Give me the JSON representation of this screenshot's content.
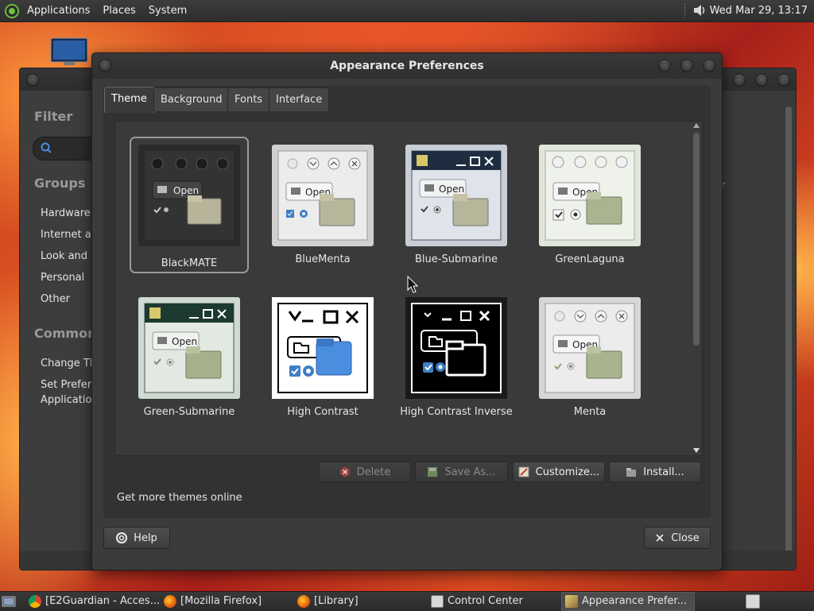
{
  "top_panel": {
    "menus": [
      "Applications",
      "Places",
      "System"
    ],
    "clock": "Wed Mar 29, 13:17"
  },
  "control_center": {
    "filter_heading": "Filter",
    "groups_heading": "Groups",
    "groups": [
      "Hardware",
      "Internet ar",
      "Look and F",
      "Personal",
      "Other"
    ],
    "common_heading": "Common",
    "common": [
      "Change Th",
      "Set Prefer",
      "Applicatio"
    ],
    "stray_char": "r"
  },
  "dialog": {
    "title": "Appearance Preferences",
    "tabs": [
      "Theme",
      "Background",
      "Fonts",
      "Interface"
    ],
    "active_tab": "Theme",
    "themes": [
      {
        "name": "BlackMATE",
        "selected": true
      },
      {
        "name": "BlueMenta",
        "selected": false
      },
      {
        "name": "Blue-Submarine",
        "selected": false
      },
      {
        "name": "GreenLaguna",
        "selected": false
      },
      {
        "name": "Green-Submarine",
        "selected": false
      },
      {
        "name": "High Contrast",
        "selected": false
      },
      {
        "name": "High Contrast Inverse",
        "selected": false
      },
      {
        "name": "Menta",
        "selected": false
      }
    ],
    "preview_open_label": "Open",
    "buttons": {
      "delete": "Delete",
      "save_as": "Save As...",
      "customize": "Customize...",
      "install": "Install..."
    },
    "more_themes_link": "Get more themes online",
    "help": "Help",
    "close": "Close"
  },
  "taskbar": {
    "tasks": [
      {
        "label": "[E2Guardian - Acces...",
        "icon": "chrome-icon"
      },
      {
        "label": "[Mozilla Firefox]",
        "icon": "firefox-icon"
      },
      {
        "label": "[Library]",
        "icon": "firefox-icon"
      },
      {
        "label": "Control Center",
        "icon": "control-center-icon"
      },
      {
        "label": "Appearance Prefer...",
        "icon": "appearance-icon",
        "active": true
      }
    ]
  },
  "colors": {
    "accent_blue": "#3d7ec4",
    "folder_green": "#8a9a6a",
    "dark_window": "#3b3b3b"
  }
}
